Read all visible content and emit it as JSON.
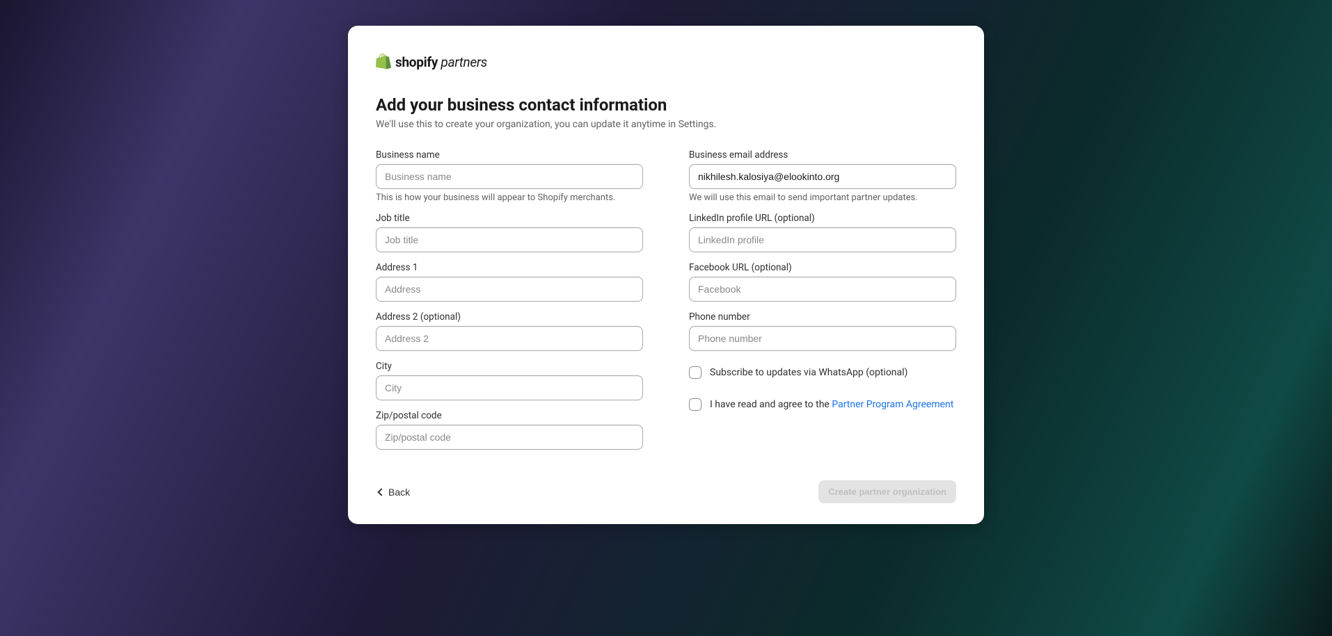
{
  "logo": {
    "brand": "shopify",
    "suffix": "partners",
    "icon": "shopify-bag-icon",
    "icon_color": "#95BF47"
  },
  "header": {
    "title": "Add your business contact information",
    "subtitle": "We'll use this to create your organization, you can update it anytime in Settings."
  },
  "left": {
    "business_name": {
      "label": "Business name",
      "placeholder": "Business name",
      "value": "",
      "help": "This is how your business will appear to Shopify merchants."
    },
    "job_title": {
      "label": "Job title",
      "placeholder": "Job title",
      "value": ""
    },
    "address1": {
      "label": "Address 1",
      "placeholder": "Address",
      "value": ""
    },
    "address2": {
      "label": "Address 2 (optional)",
      "placeholder": "Address 2",
      "value": ""
    },
    "city": {
      "label": "City",
      "placeholder": "City",
      "value": ""
    },
    "zip": {
      "label": "Zip/postal code",
      "placeholder": "Zip/postal code",
      "value": ""
    }
  },
  "right": {
    "email": {
      "label": "Business email address",
      "placeholder": "",
      "value": "nikhilesh.kalosiya@elookinto.org",
      "help": "We will use this email to send important partner updates."
    },
    "linkedin": {
      "label": "LinkedIn profile URL (optional)",
      "placeholder": "LinkedIn profile",
      "value": ""
    },
    "facebook": {
      "label": "Facebook URL (optional)",
      "placeholder": "Facebook",
      "value": ""
    },
    "phone": {
      "label": "Phone number",
      "placeholder": "Phone number",
      "value": ""
    },
    "whatsapp": {
      "label": "Subscribe to updates via WhatsApp (optional)",
      "checked": false
    },
    "agreement": {
      "prefix": "I have read and agree to the ",
      "link_text": "Partner Program Agreement",
      "checked": false
    }
  },
  "footer": {
    "back_label": "Back",
    "submit_label": "Create partner organization"
  }
}
